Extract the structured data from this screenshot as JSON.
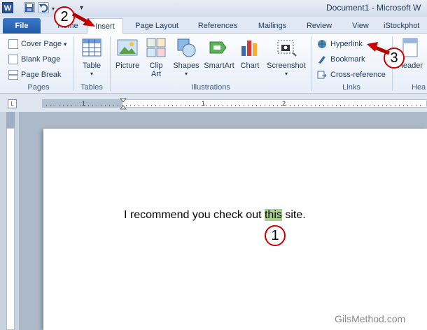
{
  "window": {
    "title": "Document1 - Microsoft W"
  },
  "tabs": [
    {
      "label": "File"
    },
    {
      "label": "Home"
    },
    {
      "label": "Insert"
    },
    {
      "label": "Page Layout"
    },
    {
      "label": "References"
    },
    {
      "label": "Mailings"
    },
    {
      "label": "Review"
    },
    {
      "label": "View"
    },
    {
      "label": "iStockphot"
    }
  ],
  "ribbon": {
    "pages": {
      "label": "Pages",
      "items": [
        "Cover Page",
        "Blank Page",
        "Page Break"
      ]
    },
    "tables": {
      "label": "Tables",
      "table_label": "Table"
    },
    "illustrations": {
      "label": "Illustrations",
      "picture": "Picture",
      "clipart_line1": "Clip",
      "clipart_line2": "Art",
      "shapes": "Shapes",
      "smartart": "SmartArt",
      "chart": "Chart",
      "screenshot": "Screenshot"
    },
    "links": {
      "label": "Links",
      "items": [
        "Hyperlink",
        "Bookmark",
        "Cross-reference"
      ]
    },
    "header": {
      "label": "Header",
      "group_label": "Hea"
    }
  },
  "ruler": {
    "numbers": [
      "1",
      "1",
      "2"
    ]
  },
  "document": {
    "text_before": "I recommend you check out ",
    "highlighted": "this",
    "text_after": " site."
  },
  "annotations": {
    "one": "1",
    "two": "2",
    "three": "3"
  },
  "watermark": "GilsMethod.com",
  "colors": {
    "file_tab": "#2b67b8",
    "highlight": "#a8d18d",
    "arrow": "#cc0000"
  }
}
